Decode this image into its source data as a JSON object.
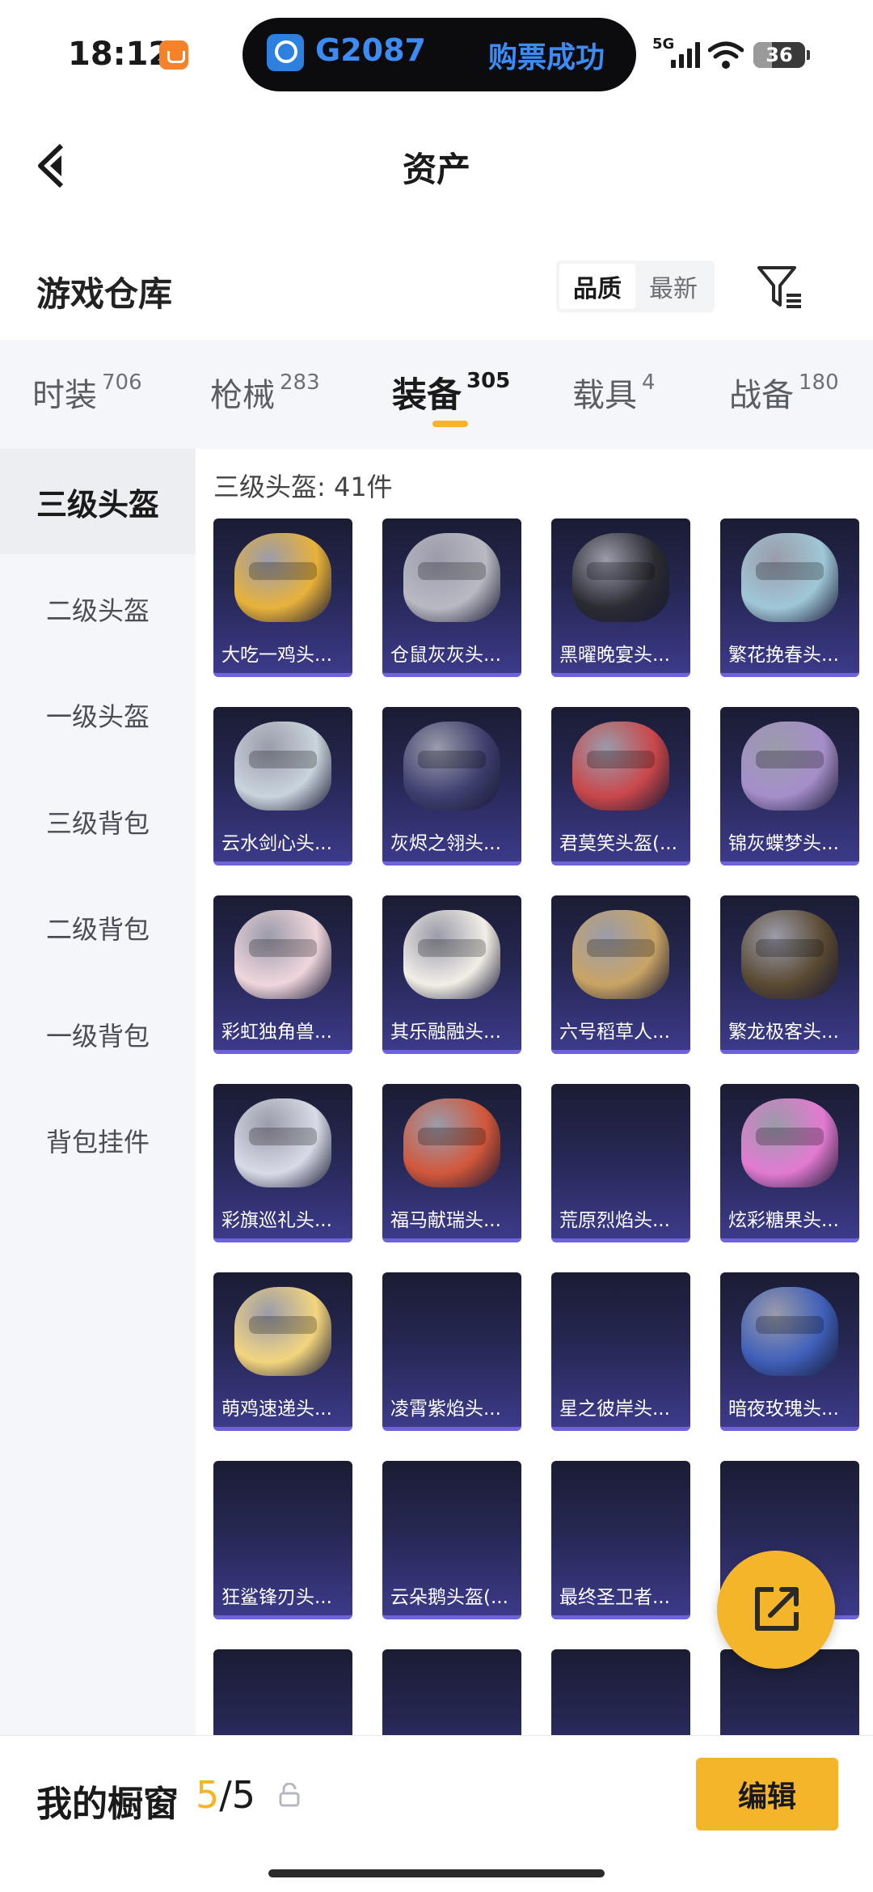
{
  "status_bar": {
    "time": "18:12",
    "island": {
      "train": "G2087",
      "status": "购票成功"
    },
    "network": "5G",
    "battery": {
      "level_text": "36",
      "level_percent": 36
    }
  },
  "header": {
    "title": "资产"
  },
  "section": {
    "title": "游戏仓库",
    "sort_options": [
      "品质",
      "最新"
    ],
    "active_sort": "品质"
  },
  "tabs": [
    {
      "label": "时装",
      "count": "706"
    },
    {
      "label": "枪械",
      "count": "283"
    },
    {
      "label": "装备",
      "count": "305",
      "active": true
    },
    {
      "label": "载具",
      "count": "4"
    },
    {
      "label": "战备",
      "count": "180"
    }
  ],
  "sidebar": [
    {
      "label": "三级头盔",
      "active": true
    },
    {
      "label": "二级头盔"
    },
    {
      "label": "一级头盔"
    },
    {
      "label": "三级背包"
    },
    {
      "label": "二级背包"
    },
    {
      "label": "一级背包"
    },
    {
      "label": "背包挂件"
    }
  ],
  "grid": {
    "count_label": "三级头盔: 41件",
    "items": [
      {
        "name": "大吃一鸡头...",
        "image": "helmet-icon",
        "color": "#e8b23a"
      },
      {
        "name": "仓鼠灰灰头...",
        "image": "helmet-icon",
        "color": "#b9b9c2"
      },
      {
        "name": "黑曜晚宴头...",
        "image": "helmet-icon",
        "color": "#2b2b32"
      },
      {
        "name": "繁花挽春头...",
        "image": "helmet-icon",
        "color": "#9fc7d6"
      },
      {
        "name": "云水剑心头...",
        "image": "helmet-icon",
        "color": "#c9d4dc"
      },
      {
        "name": "灰烬之翎头...",
        "image": "helmet-icon",
        "color": "#3d3f6e"
      },
      {
        "name": "君莫笑头盔(...",
        "image": "helmet-icon",
        "color": "#c9474a"
      },
      {
        "name": "锦灰蝶梦头...",
        "image": "helmet-icon",
        "color": "#a58ec9"
      },
      {
        "name": "彩虹独角兽...",
        "image": "helmet-icon",
        "color": "#f0d6dc"
      },
      {
        "name": "其乐融融头...",
        "image": "helmet-icon",
        "color": "#f2eee6"
      },
      {
        "name": "六号稻草人...",
        "image": "helmet-icon",
        "color": "#c9a464"
      },
      {
        "name": "繁龙极客头...",
        "image": "helmet-icon",
        "color": "#5a4a32"
      },
      {
        "name": "彩旗巡礼头...",
        "image": "helmet-icon",
        "color": "#d8dbe6"
      },
      {
        "name": "福马献瑞头...",
        "image": "helmet-icon",
        "color": "#d2573a"
      },
      {
        "name": "荒原烈焰头...",
        "image": "",
        "color": ""
      },
      {
        "name": "炫彩糖果头...",
        "image": "helmet-icon",
        "color": "#e27ad0"
      },
      {
        "name": "萌鸡速递头...",
        "image": "helmet-icon",
        "color": "#f3d57e"
      },
      {
        "name": "凌霄紫焰头...",
        "image": "",
        "color": ""
      },
      {
        "name": "星之彼岸头...",
        "image": "",
        "color": ""
      },
      {
        "name": "暗夜玫瑰头...",
        "image": "helmet-icon",
        "color": "#3f5fb8"
      },
      {
        "name": "狂鲨锋刃头...",
        "image": "",
        "color": ""
      },
      {
        "name": "云朵鹅头盔(...",
        "image": "",
        "color": ""
      },
      {
        "name": "最终圣卫者...",
        "image": "",
        "color": ""
      },
      {
        "name": "",
        "image": "",
        "color": ""
      },
      {
        "name": "",
        "image": "",
        "color": ""
      },
      {
        "name": "",
        "image": "",
        "color": ""
      },
      {
        "name": "",
        "image": "",
        "color": ""
      },
      {
        "name": "",
        "image": "",
        "color": ""
      }
    ]
  },
  "bottom": {
    "showcase_label": "我的橱窗",
    "showcase_current": "5",
    "showcase_sep": "/",
    "showcase_total": "5",
    "edit_label": "编辑"
  },
  "icons": {
    "back": "back-arrow-icon",
    "filter": "filter-icon",
    "lock": "lock-icon",
    "share": "share-icon"
  },
  "colors": {
    "accent": "#f5b52a",
    "card_bottom": "#6e63d9"
  }
}
